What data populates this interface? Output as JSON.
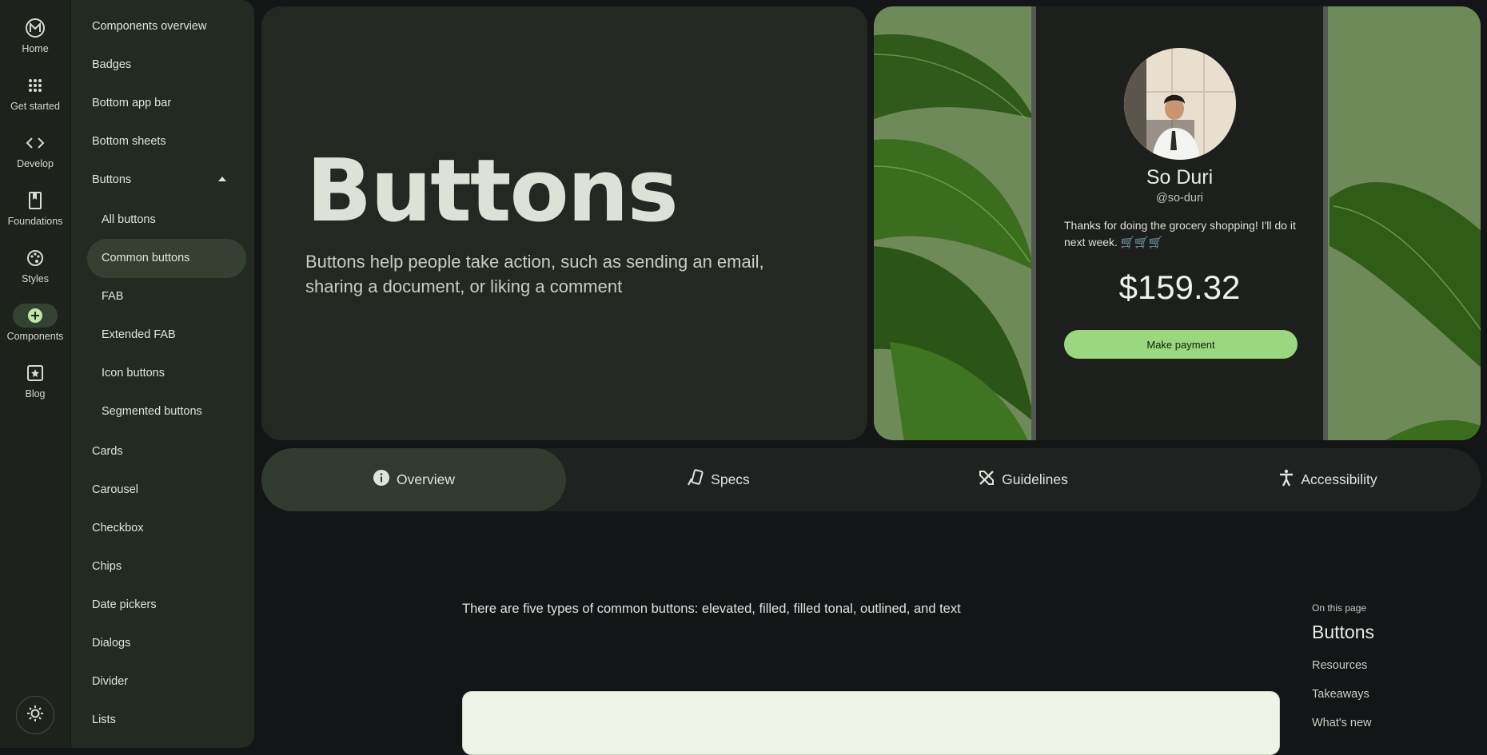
{
  "rail": {
    "items": [
      {
        "label": "Home",
        "icon": "material-logo-icon"
      },
      {
        "label": "Get started",
        "icon": "apps-grid-icon"
      },
      {
        "label": "Develop",
        "icon": "code-icon"
      },
      {
        "label": "Foundations",
        "icon": "book-icon"
      },
      {
        "label": "Styles",
        "icon": "palette-icon"
      },
      {
        "label": "Components",
        "icon": "add-circle-icon"
      },
      {
        "label": "Blog",
        "icon": "star-document-icon"
      }
    ],
    "active": "Components"
  },
  "drawer": {
    "items": [
      "Components overview",
      "Badges",
      "Bottom app bar",
      "Bottom sheets",
      "Buttons",
      "All buttons",
      "Common buttons",
      "FAB",
      "Extended FAB",
      "Icon buttons",
      "Segmented buttons",
      "Cards",
      "Carousel",
      "Checkbox",
      "Chips",
      "Date pickers",
      "Dialogs",
      "Divider",
      "Lists"
    ],
    "active": "Common buttons"
  },
  "hero": {
    "title": "Buttons",
    "description": "Buttons help people take action, such as sending an email, sharing a document, or liking a comment"
  },
  "profile_card": {
    "name": "So Duri",
    "handle": "@so-duri",
    "message": "Thanks for doing the grocery shopping! I'll do it next week. 🛒🛒🛒",
    "amount": "$159.32",
    "button": "Make payment"
  },
  "tabs": [
    {
      "label": "Overview",
      "icon": "info-icon",
      "active": true
    },
    {
      "label": "Specs",
      "icon": "ruler-phone-icon",
      "active": false
    },
    {
      "label": "Guidelines",
      "icon": "design-tools-icon",
      "active": false
    },
    {
      "label": "Accessibility",
      "icon": "accessibility-icon",
      "active": false
    }
  ],
  "content": {
    "intro": "There are five types of common buttons: elevated, filled, filled tonal, outlined, and text"
  },
  "toc": {
    "label": "On this page",
    "title": "Buttons",
    "links": [
      "Resources",
      "Takeaways",
      "What's new"
    ]
  },
  "colors": {
    "background": "#141517",
    "accent": "#9ad77f",
    "drawer": "#232a22",
    "active_tab": "#323a2f"
  }
}
